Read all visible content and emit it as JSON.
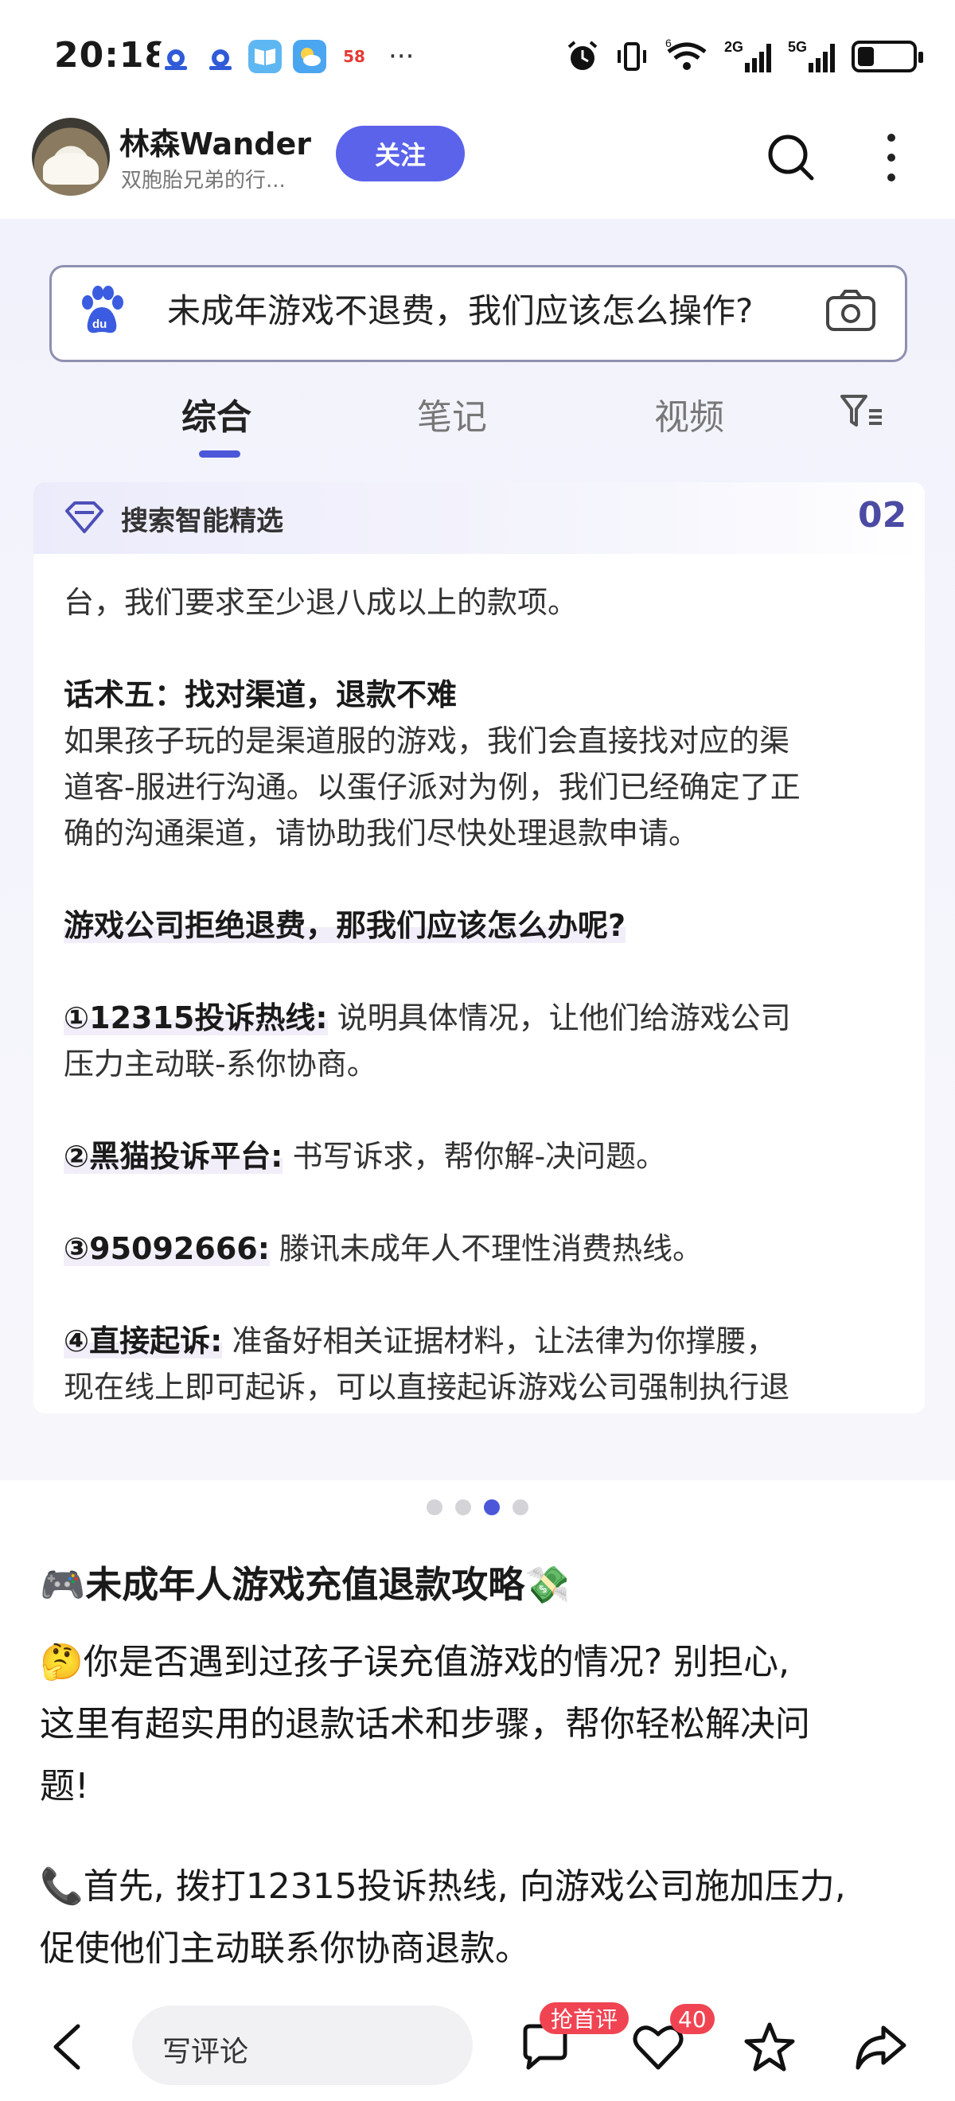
{
  "status_bar": {
    "time": "20:18",
    "app_icons": [
      "baidu-paw-icon",
      "baidu-paw-icon",
      "book-icon",
      "weather-icon",
      "58-app-icon"
    ],
    "app_58_label": "58",
    "more": "···",
    "network_1": "2G",
    "network_2": "5G",
    "wifi_sub": "6",
    "battery_level": 0.3
  },
  "header": {
    "author_name": "林森Wander",
    "author_desc": "双胞胎兄弟的行...",
    "follow_label": "关注"
  },
  "card": {
    "search_query": "未成年游戏不退费，我们应该怎么操作?",
    "tabs": [
      {
        "label": "综合",
        "active": true
      },
      {
        "label": "笔记",
        "active": false
      },
      {
        "label": "视频",
        "active": false
      }
    ],
    "head_label": "搜索智能精选",
    "page_num": "02",
    "lines": {
      "l1": "台，我们要求至少退八成以上的款项。",
      "l2": "话术五：找对渠道，退款不难",
      "l3": "如果孩子玩的是渠道服的游戏，我们会直接找对应的渠",
      "l4": "道客-服进行沟通。以蛋仔派对为例，我们已经确定了正",
      "l5": "确的沟通渠道，请协助我们尽快处理退款申请。",
      "l6": "游戏公司拒绝退费，那我们应该怎么办呢?",
      "l7_bold": "①12315投诉热线:",
      "l7_rest": " 说明具体情况，让他们给游戏公司",
      "l8": "压力主动联-系你协商。",
      "l9_bold": "②黑猫投诉平台:",
      "l9_rest": " 书写诉求，帮你解-决问题。",
      "l10_bold": "③95092666:",
      "l10_rest": " 滕讯未成年人不理性消费热线。",
      "l11_bold": "④直接起诉:",
      "l11_rest": " 准备好相关证据材料，让法律为你撑腰，",
      "l12": "现在线上即可起诉，可以直接起诉游戏公司强制执行退"
    }
  },
  "pagination": {
    "total": 4,
    "active_index": 2
  },
  "post": {
    "title_emoji": "🎮",
    "title": "未成年人游戏充值退款攻略",
    "title_end_emoji": "💸",
    "p1_line1_emoji": "🤔",
    "p1_line1": "你是否遇到过孩子误充值游戏的情况? 别担心,",
    "p1_line2": "这里有超实用的退款话术和步骤，帮你轻松解决问",
    "p1_line3": "题!",
    "p2_line1_emoji": "📞",
    "p2_line1": "首先, 拨打12315投诉热线, 向游戏公司施加压力,",
    "p2_line2": "促使他们主动联系你协商退款。"
  },
  "bottom_bar": {
    "comment_placeholder": "写评论",
    "first_comment_badge": "抢首评",
    "like_count": "40"
  }
}
